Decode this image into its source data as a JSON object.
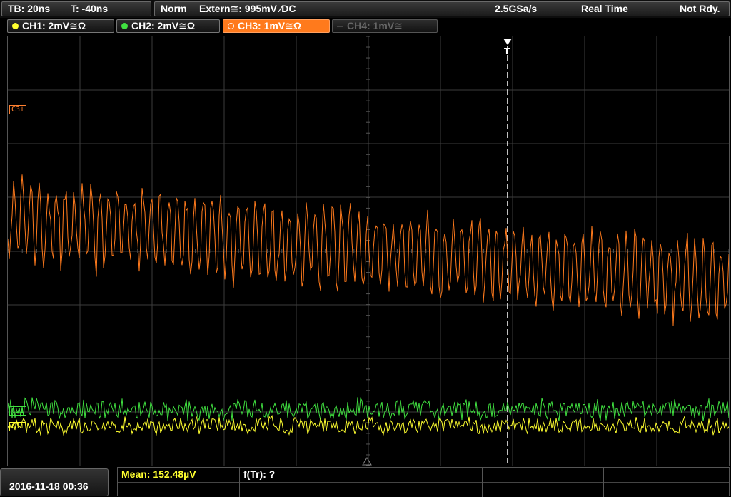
{
  "topbar": {
    "timebase": "TB: 20ns",
    "trigger_time": "T: -40ns",
    "mode": "Norm",
    "trigger_source": "Extern≅: 995mV ⁄DC",
    "sample_rate": "2.5GSa/s",
    "acq_mode": "Real Time",
    "status": "Not Rdy."
  },
  "channels": [
    {
      "label": "CH1: 2mV≅Ω",
      "color": "#ffff30",
      "active": true
    },
    {
      "label": "CH2: 2mV≅Ω",
      "color": "#40e040",
      "active": true
    },
    {
      "label": "CH3: 1mV≅Ω",
      "color": "#ff7a1c",
      "active": true
    },
    {
      "label": "CH4: 1mV≅",
      "color": "#666666",
      "active": false
    }
  ],
  "markers": {
    "c3": "C3⊥",
    "c2": "C2⊥",
    "c1": "C1⊥",
    "trigger": "T"
  },
  "bottom": {
    "datetime": "2016-11-18 00:36",
    "mean": "Mean: 152.48µV",
    "ftr": "f(Tr): ?"
  },
  "colors": {
    "ch1": "#ffff30",
    "ch2": "#40e040",
    "ch3": "#ff7a1c",
    "grid": "#3c3c3c",
    "trigger_line": "#ffffff"
  }
}
